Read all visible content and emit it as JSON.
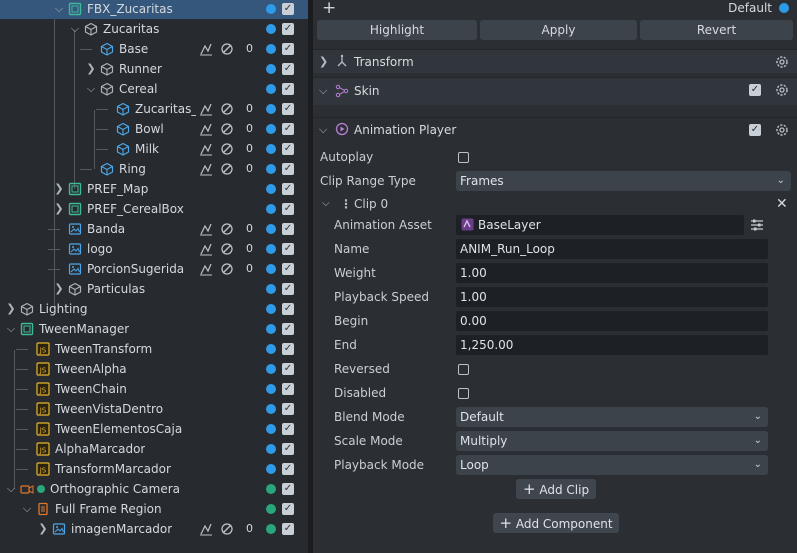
{
  "hierarchy": {
    "rows": [
      {
        "name": "FBX_Zucaritas",
        "depth": 3,
        "arrow": "down",
        "icon": "prefab-icon",
        "selected": true,
        "dot": "blue",
        "layer": "",
        "flags": false
      },
      {
        "name": "Zucaritas",
        "depth": 4,
        "arrow": "down",
        "icon": "model-icon",
        "dot": "blue",
        "layer": "",
        "flags": false
      },
      {
        "name": "Base",
        "depth": 5,
        "arrow": "",
        "icon": "mesh-icon",
        "dot": "blue",
        "layer": "0",
        "flags": true
      },
      {
        "name": "Runner",
        "depth": 5,
        "arrow": "right",
        "icon": "model-icon",
        "dot": "blue",
        "layer": "",
        "flags": false
      },
      {
        "name": "Cereal",
        "depth": 5,
        "arrow": "down",
        "icon": "model-icon",
        "dot": "blue",
        "layer": "",
        "flags": false
      },
      {
        "name": "Zucaritas_:",
        "depth": 6,
        "arrow": "",
        "icon": "mesh-icon",
        "dot": "blue",
        "layer": "0",
        "flags": true
      },
      {
        "name": "Bowl",
        "depth": 6,
        "arrow": "",
        "icon": "mesh-icon",
        "dot": "blue",
        "layer": "0",
        "flags": true
      },
      {
        "name": "Milk",
        "depth": 6,
        "arrow": "",
        "icon": "mesh-icon",
        "dot": "blue",
        "layer": "0",
        "flags": true
      },
      {
        "name": "Ring",
        "depth": 5,
        "arrow": "",
        "icon": "mesh-icon",
        "dot": "blue",
        "layer": "0",
        "flags": true
      },
      {
        "name": "PREF_Map",
        "depth": 3,
        "arrow": "right",
        "icon": "prefab-icon",
        "dot": "blue",
        "layer": "",
        "flags": false
      },
      {
        "name": "PREF_CerealBox",
        "depth": 3,
        "arrow": "right",
        "icon": "prefab-icon",
        "dot": "blue",
        "layer": "",
        "flags": false
      },
      {
        "name": "Banda",
        "depth": 3,
        "arrow": "",
        "icon": "image-icon",
        "dot": "blue",
        "layer": "0",
        "flags": true
      },
      {
        "name": "logo",
        "depth": 3,
        "arrow": "",
        "icon": "image-icon",
        "dot": "blue",
        "layer": "0",
        "flags": true
      },
      {
        "name": "PorcionSugerida",
        "depth": 3,
        "arrow": "",
        "icon": "image-icon",
        "dot": "blue",
        "layer": "0",
        "flags": true
      },
      {
        "name": "Particulas",
        "depth": 3,
        "arrow": "right",
        "icon": "model-icon",
        "dot": "blue",
        "layer": "",
        "flags": false
      },
      {
        "name": "Lighting",
        "depth": 0,
        "arrow": "right",
        "icon": "model-icon",
        "dot": "blue",
        "layer": "",
        "flags": false
      },
      {
        "name": "TweenManager",
        "depth": 0,
        "arrow": "down",
        "icon": "prefab-icon",
        "dot": "blue",
        "layer": "",
        "flags": false
      },
      {
        "name": "TweenTransform",
        "depth": 1,
        "arrow": "",
        "icon": "script-icon",
        "dot": "blue",
        "layer": "",
        "flags": false
      },
      {
        "name": "TweenAlpha",
        "depth": 1,
        "arrow": "",
        "icon": "script-icon",
        "dot": "blue",
        "layer": "",
        "flags": false
      },
      {
        "name": "TweenChain",
        "depth": 1,
        "arrow": "",
        "icon": "script-icon",
        "dot": "blue",
        "layer": "",
        "flags": false
      },
      {
        "name": "TweenVistaDentro",
        "depth": 1,
        "arrow": "",
        "icon": "script-icon",
        "dot": "blue",
        "layer": "",
        "flags": false
      },
      {
        "name": "TweenElementosCaja",
        "depth": 1,
        "arrow": "",
        "icon": "script-icon",
        "dot": "blue",
        "layer": "",
        "flags": false
      },
      {
        "name": "AlphaMarcador",
        "depth": 1,
        "arrow": "",
        "icon": "script-icon",
        "dot": "blue",
        "layer": "",
        "flags": false
      },
      {
        "name": "TransformMarcador",
        "depth": 1,
        "arrow": "",
        "icon": "script-icon",
        "dot": "blue",
        "layer": "",
        "flags": false
      },
      {
        "name": "Orthographic Camera",
        "depth": 0,
        "arrow": "down",
        "icon": "camera-icon",
        "dot": "green",
        "layer": "",
        "flags": false
      },
      {
        "name": "Full Frame Region",
        "depth": 1,
        "arrow": "down",
        "icon": "region-icon",
        "dot": "green",
        "layer": "",
        "flags": false
      },
      {
        "name": "imagenMarcador",
        "depth": 2,
        "arrow": "right",
        "icon": "image-icon",
        "dot": "green",
        "layer": "0",
        "flags": true
      }
    ]
  },
  "inspector": {
    "default_label": "Default",
    "buttons": {
      "highlight": "Highlight",
      "apply": "Apply",
      "revert": "Revert"
    },
    "components": {
      "transform": "Transform",
      "skin": "Skin",
      "animation_player": "Animation Player"
    },
    "autoplay_label": "Autoplay",
    "clip_range_type_label": "Clip Range Type",
    "clip_range_type_value": "Frames",
    "clip_title": "Clip 0",
    "props": {
      "animation_asset_label": "Animation Asset",
      "animation_asset_value": "BaseLayer",
      "name_label": "Name",
      "name_value": "ANIM_Run_Loop",
      "weight_label": "Weight",
      "weight_value": "1.00",
      "playback_speed_label": "Playback Speed",
      "playback_speed_value": "1.00",
      "begin_label": "Begin",
      "begin_value": "0.00",
      "end_label": "End",
      "end_value": "1,250.00",
      "reversed_label": "Reversed",
      "disabled_label": "Disabled",
      "blend_mode_label": "Blend Mode",
      "blend_mode_value": "Default",
      "scale_mode_label": "Scale Mode",
      "scale_mode_value": "Multiply",
      "playback_mode_label": "Playback Mode",
      "playback_mode_value": "Loop"
    },
    "add_clip": "Add Clip",
    "add_component": "Add Component"
  },
  "colors": {
    "accent_blue": "#2e9be8",
    "accent_green": "#2aa77a",
    "selection": "#36577c",
    "script_yellow": "#e8b32a",
    "camera_orange": "#e0762a",
    "prefab_green": "#3fb89a"
  }
}
